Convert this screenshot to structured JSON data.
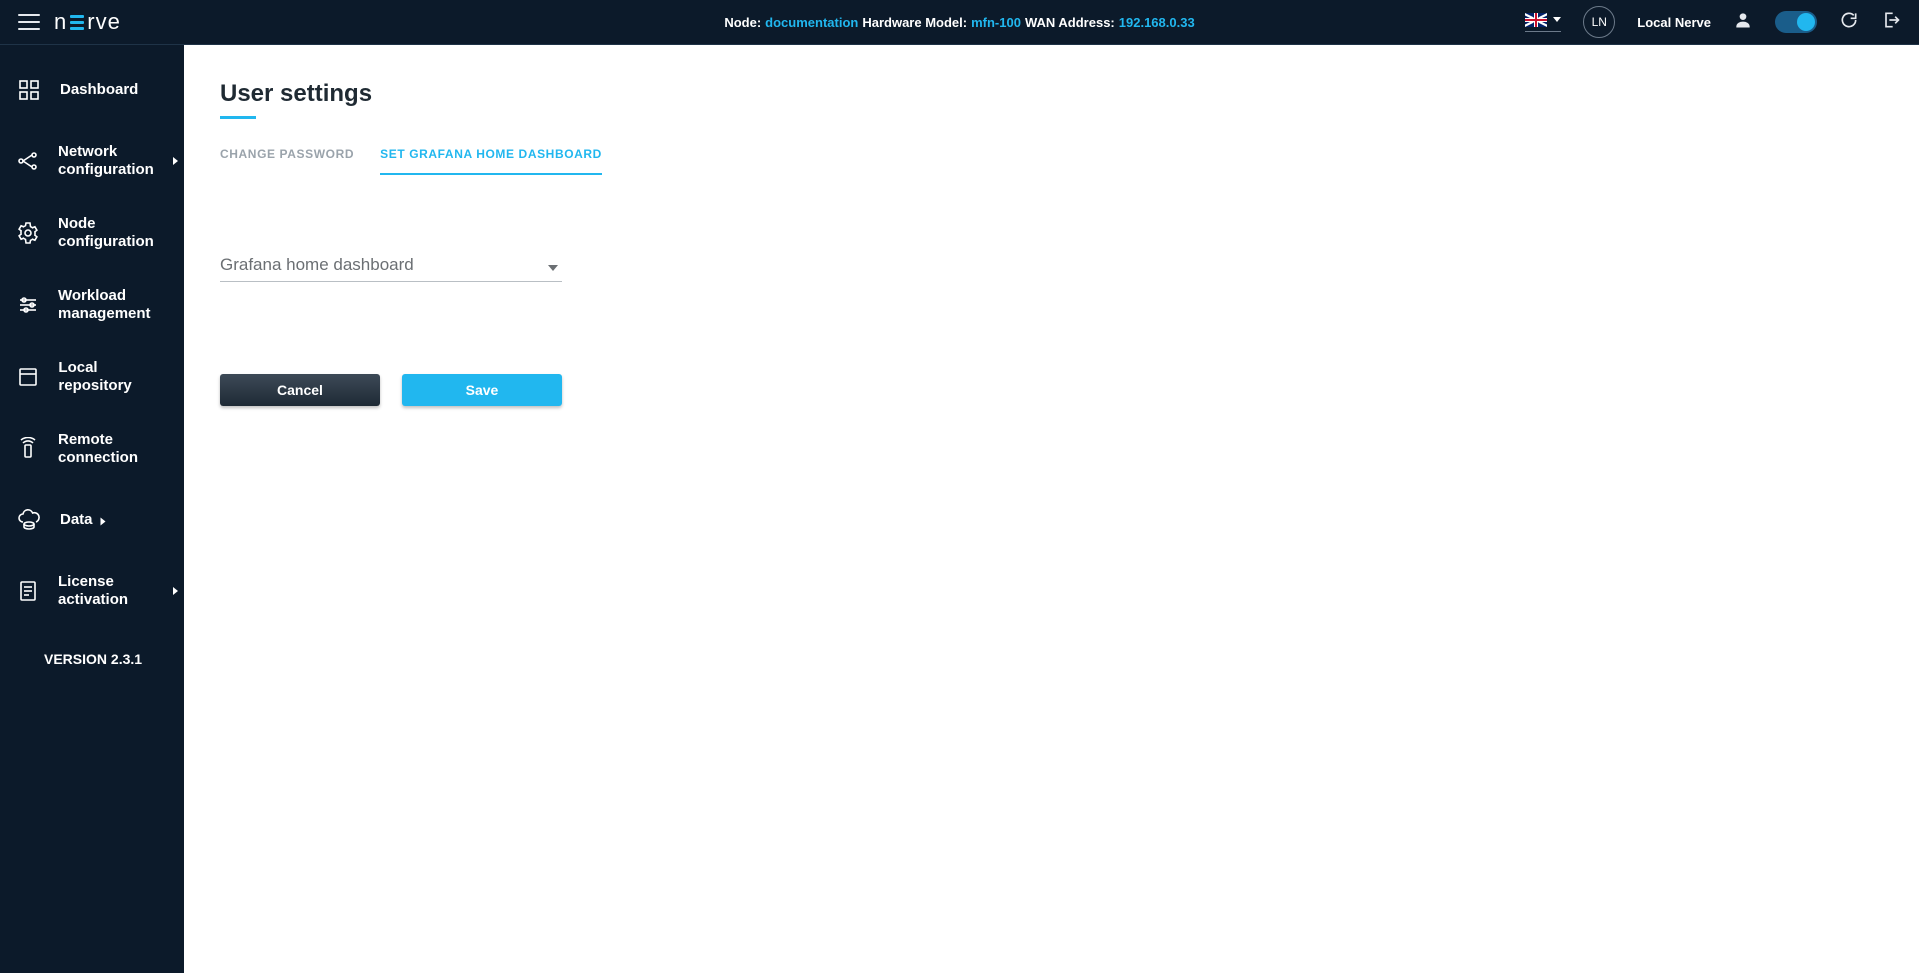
{
  "topbar": {
    "node_label": "Node:",
    "node_value": "documentation",
    "model_label": "Hardware Model:",
    "model_value": "mfn-100",
    "wan_label": "WAN Address:",
    "wan_value": "192.168.0.33",
    "avatar_initials": "LN",
    "username": "Local Nerve"
  },
  "sidebar": {
    "items": [
      {
        "label": "Dashboard"
      },
      {
        "label": "Network configuration"
      },
      {
        "label": "Node configuration"
      },
      {
        "label": "Workload management"
      },
      {
        "label": "Local repository"
      },
      {
        "label": "Remote connection"
      },
      {
        "label": "Data"
      },
      {
        "label": "License activation"
      }
    ],
    "version": "VERSION 2.3.1"
  },
  "main": {
    "title": "User settings",
    "tabs": [
      {
        "label": "CHANGE PASSWORD"
      },
      {
        "label": "SET GRAFANA HOME DASHBOARD"
      }
    ],
    "field_label": "Grafana home dashboard",
    "cancel_label": "Cancel",
    "save_label": "Save"
  }
}
